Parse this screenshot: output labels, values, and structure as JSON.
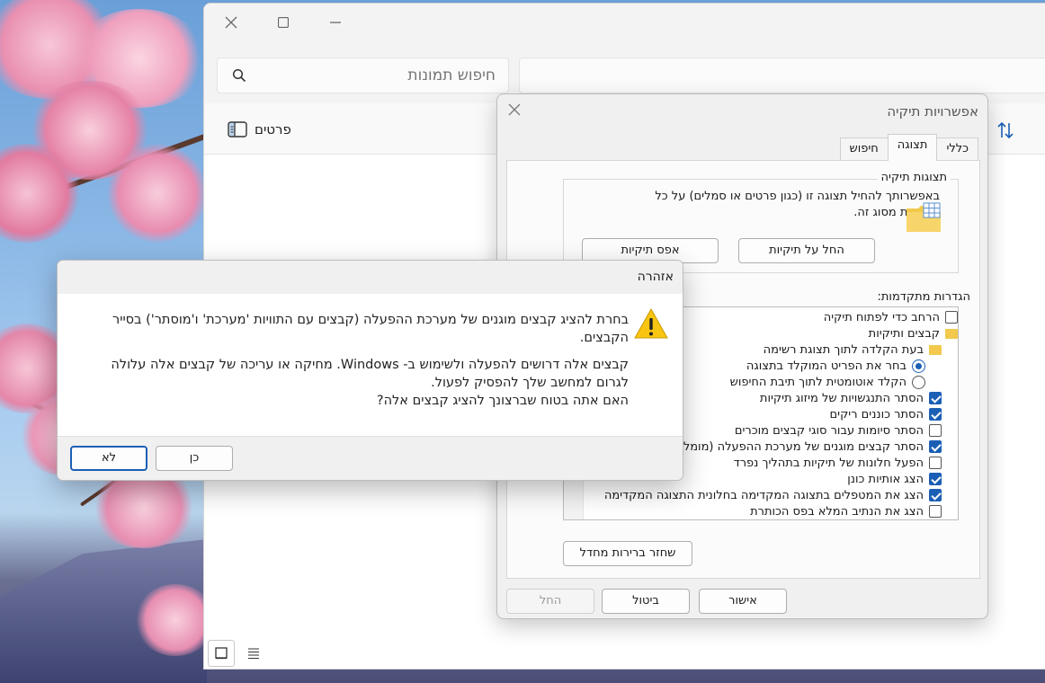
{
  "photos_window": {
    "search_placeholder": "חיפוש תמונות",
    "details_label": "פרטים"
  },
  "folder_options": {
    "title": "אפשרויות תיקיה",
    "tabs": [
      "כללי",
      "תצוגה",
      "חיפוש"
    ],
    "active_tab": "תצוגה",
    "folder_views_legend": "תצוגות תיקיה",
    "folder_views_text": "באפשרותך להחיל תצוגה זו (כגון פרטים או סמלים) על כל התיקיות מסוג זה.",
    "apply_folders_label": "החל על תיקיות",
    "reset_folders_label": "אפס תיקיות",
    "advanced_label": "הגדרות מתקדמות:",
    "advanced_items": [
      {
        "kind": "checkbox",
        "checked": false,
        "label": "הרחב כדי לפתוח תיקיה"
      },
      {
        "kind": "folder",
        "label": "קבצים ותיקיות"
      },
      {
        "kind": "folder",
        "label": "בעת הקלדה לתוך תצוגת רשימה"
      },
      {
        "kind": "radio",
        "checked": true,
        "label": "בחר את הפריט המוקלד בתצוגה"
      },
      {
        "kind": "radio",
        "checked": false,
        "label": "הקלד אוטומטית לתוך תיבת החיפוש"
      },
      {
        "kind": "checkbox",
        "checked": true,
        "label": "הסתר התנגשויות של מיזוג תיקיות"
      },
      {
        "kind": "checkbox",
        "checked": true,
        "label": "הסתר כוננים ריקים"
      },
      {
        "kind": "checkbox",
        "checked": false,
        "label": "הסתר סיומות עבור סוגי קבצים מוכרים"
      },
      {
        "kind": "checkbox",
        "checked": true,
        "label": "הסתר קבצים מוגנים של מערכת ההפעלה (מומלץ)"
      },
      {
        "kind": "checkbox",
        "checked": false,
        "label": "הפעל חלונות של תיקיות בתהליך נפרד"
      },
      {
        "kind": "checkbox",
        "checked": true,
        "label": "הצג אותיות כונן"
      },
      {
        "kind": "checkbox",
        "checked": true,
        "label": "הצג את המטפלים בתצוגה המקדימה בחלונית התצוגה המקדימה"
      },
      {
        "kind": "checkbox",
        "checked": false,
        "label": "הצג את הנתיב המלא בפס הכותרת"
      }
    ],
    "restore_defaults_label": "שחזר ברירות מחדל",
    "ok_label": "אישור",
    "cancel_label": "ביטול",
    "apply_label": "החל"
  },
  "warning": {
    "title": "אזהרה",
    "message_line1": "בחרת להציג קבצים מוגנים של מערכת ההפעלה (קבצים עם התוויות 'מערכת' ו'מוסתר') בסייר הקבצים.",
    "message_line2": "קבצים אלה דרושים להפעלה ולשימוש ב- Windows. מחיקה או עריכה של קבצים אלה עלולה לגרום למחשב שלך להפסיק לפעול.",
    "message_line3": "האם אתה בטוח שברצונך להציג קבצים אלה?",
    "yes_label": "כן",
    "no_label": "לא"
  }
}
